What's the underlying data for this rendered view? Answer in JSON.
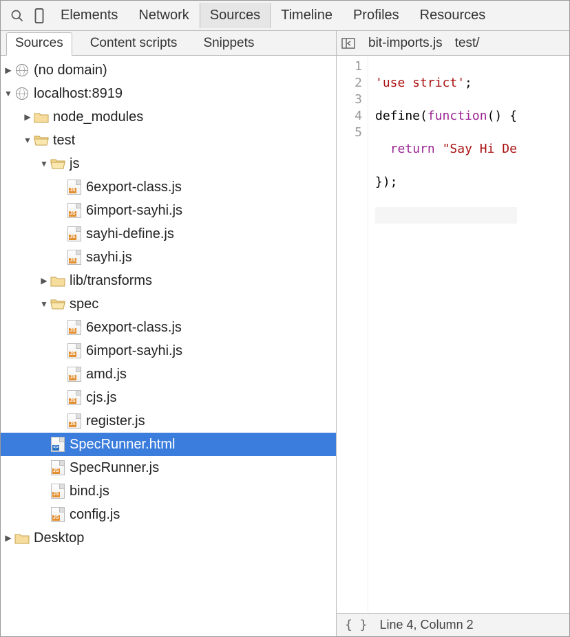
{
  "toolbar": {
    "tabs": [
      "Elements",
      "Network",
      "Sources",
      "Timeline",
      "Profiles",
      "Resources"
    ],
    "active_tab_index": 2
  },
  "left": {
    "sub_tabs": [
      "Sources",
      "Content scripts",
      "Snippets"
    ],
    "active_sub_tab_index": 0,
    "tree": {
      "no_domain": "(no domain)",
      "host": "localhost:8919",
      "node_modules": "node_modules",
      "test": "test",
      "js": "js",
      "f_6export_class": "6export-class.js",
      "f_6import_sayhi": "6import-sayhi.js",
      "f_sayhi_define": "sayhi-define.js",
      "f_sayhi": "sayhi.js",
      "lib_transforms": "lib/transforms",
      "spec": "spec",
      "s_6export_class": "6export-class.js",
      "s_6import_sayhi": "6import-sayhi.js",
      "s_amd": "amd.js",
      "s_cjs": "cjs.js",
      "s_register": "register.js",
      "specrunner_html": "SpecRunner.html",
      "specrunner_js": "SpecRunner.js",
      "bind_js": "bind.js",
      "config_js": "config.js",
      "desktop": "Desktop"
    }
  },
  "editor": {
    "tabs": [
      "bit-imports.js",
      "test/"
    ],
    "gutter": [
      "1",
      "2",
      "3",
      "4",
      "5"
    ],
    "code": {
      "l1_str": "'use strict'",
      "l1_semi": ";",
      "l2_define": "define(",
      "l2_function": "function",
      "l2_rest": "() {",
      "l3_indent": "  ",
      "l3_return": "return",
      "l3_space": " ",
      "l3_str": "\"Say Hi De",
      "l4": "});"
    }
  },
  "status": {
    "position": "Line 4, Column 2"
  }
}
